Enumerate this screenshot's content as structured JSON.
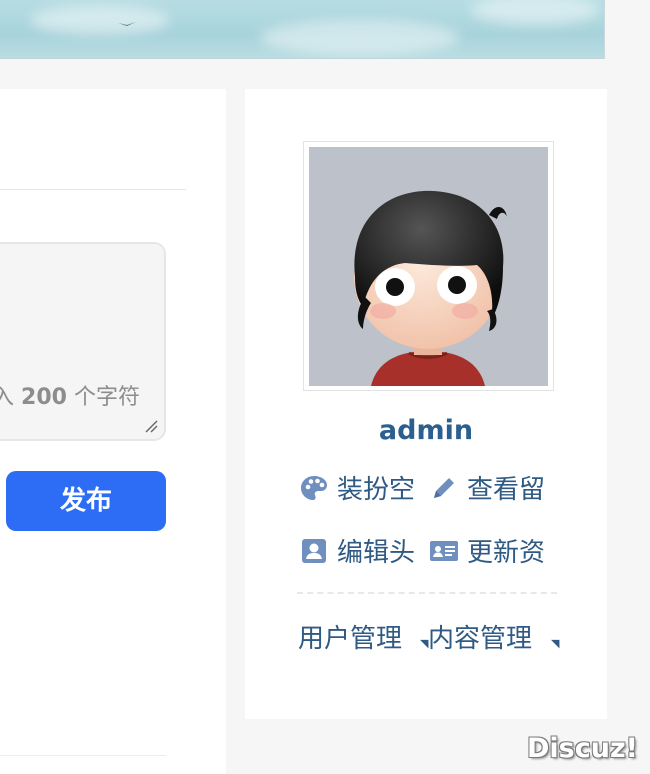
{
  "theme": {
    "accent": "#2d6df6",
    "link_color": "#2f5a84",
    "username_color": "#2b5f8f",
    "page_bg": "#f6f6f6"
  },
  "composer": {
    "char_hint_prefix": "入",
    "char_hint_count": "200",
    "char_hint_suffix": "个字符",
    "publish_label": "发布"
  },
  "profile": {
    "username": "admin",
    "actions": [
      {
        "label": "装扮空",
        "icon": "palette-icon"
      },
      {
        "label": "查看留",
        "icon": "pencil-icon"
      },
      {
        "label": "编辑头",
        "icon": "portrait-icon"
      },
      {
        "label": "更新资",
        "icon": "id-card-icon"
      }
    ],
    "admin_links": [
      {
        "label": "用户管理"
      },
      {
        "label": "内容管理"
      }
    ]
  },
  "watermark": "Discuz!"
}
